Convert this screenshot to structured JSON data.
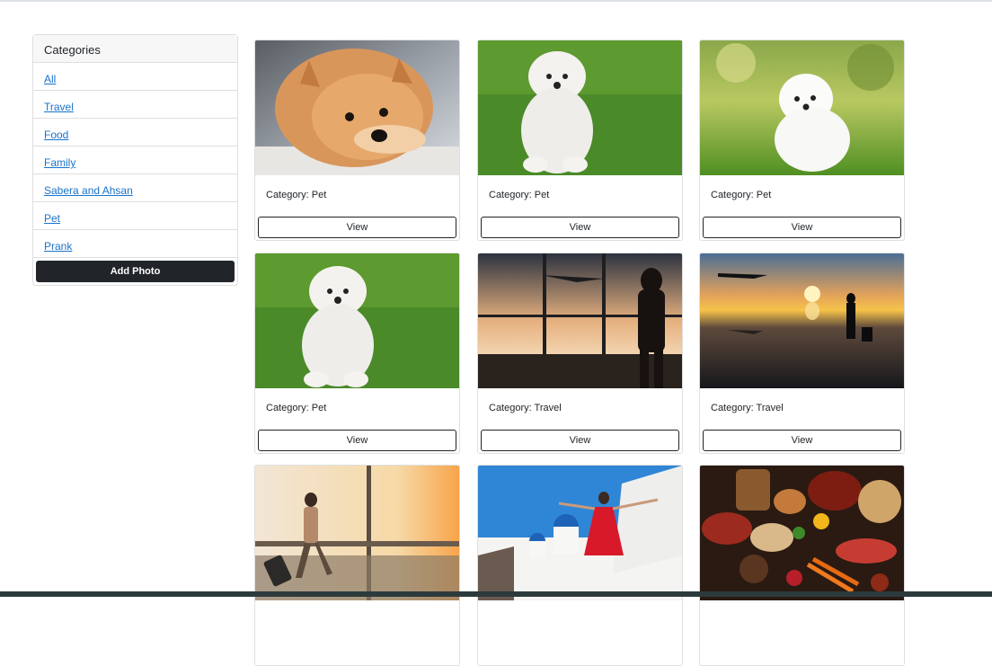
{
  "sidebar": {
    "header": "Categories",
    "items": [
      {
        "label": "All"
      },
      {
        "label": "Travel"
      },
      {
        "label": "Food"
      },
      {
        "label": "Family"
      },
      {
        "label": "Sabera and Ahsan"
      },
      {
        "label": "Pet"
      },
      {
        "label": "Prank"
      }
    ],
    "add_photo_label": "Add Photo"
  },
  "cards": [
    {
      "category": "Category: Pet",
      "view_label": "View",
      "image": "pomeranian-dog-photo"
    },
    {
      "category": "Category: Pet",
      "view_label": "View",
      "image": "white-maltese-dog-on-grass-photo"
    },
    {
      "category": "Category: Pet",
      "view_label": "View",
      "image": "white-pomeranian-puppy-on-grass-photo"
    },
    {
      "category": "Category: Pet",
      "view_label": "View",
      "image": "white-maltese-dog-on-grass-photo"
    },
    {
      "category": "Category: Travel",
      "view_label": "View",
      "image": "airport-window-traveler-silhouette-photo"
    },
    {
      "category": "Category: Travel",
      "view_label": "View",
      "image": "sunset-traveler-with-airplane-photo"
    },
    {
      "image": "woman-with-suitcase-in-terminal-photo"
    },
    {
      "image": "woman-in-red-dress-santorini-photo"
    },
    {
      "image": "assorted-food-table-photo"
    }
  ]
}
